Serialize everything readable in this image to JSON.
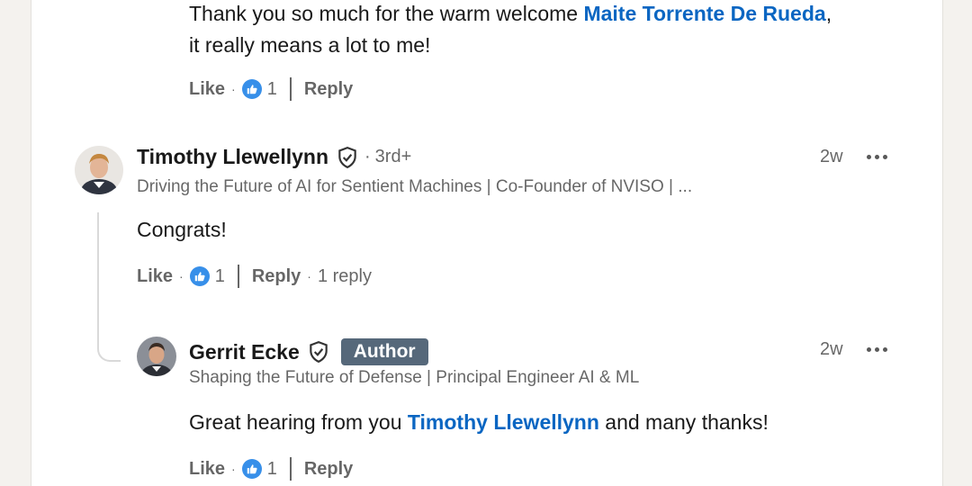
{
  "reply_top": {
    "text_before": "Thank you so much for the warm welcome ",
    "mention": "Maite Torrente De Rueda",
    "text_after": ",",
    "line2": "it really means a lot to me!",
    "like_label": "Like",
    "like_count": "1",
    "reply_label": "Reply"
  },
  "comment": {
    "author_name": "Timothy Llewellynn",
    "degree": "3rd+",
    "headline": "Driving the Future of AI for Sentient Machines | Co-Founder of NVISO | ...",
    "time": "2w",
    "text": "Congrats!",
    "like_label": "Like",
    "like_count": "1",
    "reply_label": "Reply",
    "replies_label": "1 reply",
    "avatar_icon": "avatar-photo"
  },
  "nested_reply": {
    "author_name": "Gerrit Ecke",
    "badge": "Author",
    "headline": "Shaping the Future of Defense | Principal Engineer AI & ML",
    "time": "2w",
    "text_before": "Great hearing from you ",
    "mention": "Timothy Llewellynn",
    "text_after": " and many thanks!",
    "like_label": "Like",
    "like_count": "1",
    "reply_label": "Reply",
    "avatar_icon": "avatar-photo"
  },
  "icons": {
    "verified": "verified-shield-icon",
    "like_reaction": "thumbs-up-icon",
    "more": "more-options-icon"
  },
  "colors": {
    "link": "#0a66c2",
    "like_badge": "#378fe9",
    "author_badge": "#56687a",
    "page_bg": "#f4f2ee"
  }
}
